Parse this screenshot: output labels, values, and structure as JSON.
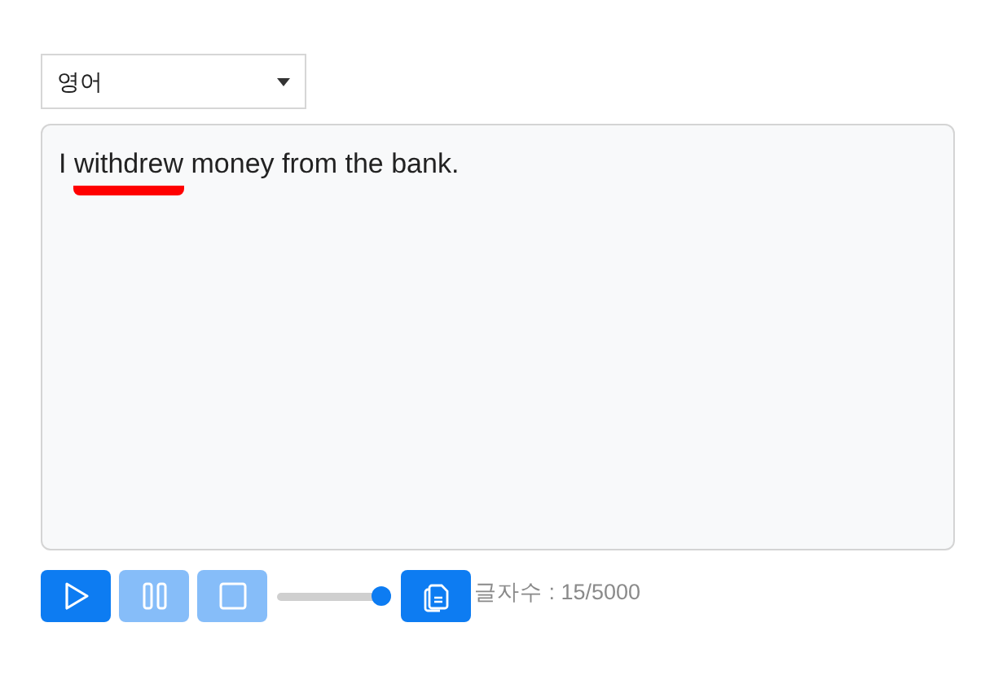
{
  "language_select": {
    "value": "영어"
  },
  "text_area": {
    "segments": [
      {
        "text": "I ",
        "marked": false
      },
      {
        "text": "withdrew",
        "marked": true
      },
      {
        "text": " money from the bank.",
        "marked": false
      }
    ]
  },
  "controls": [
    {
      "kind": "play",
      "disabled": false
    },
    {
      "kind": "pause",
      "disabled": true
    },
    {
      "kind": "stop",
      "disabled": true
    },
    {
      "kind": "slider",
      "level": 1.0
    },
    {
      "kind": "copy",
      "disabled": false
    }
  ],
  "char_count": "글자수 : 15/5000"
}
